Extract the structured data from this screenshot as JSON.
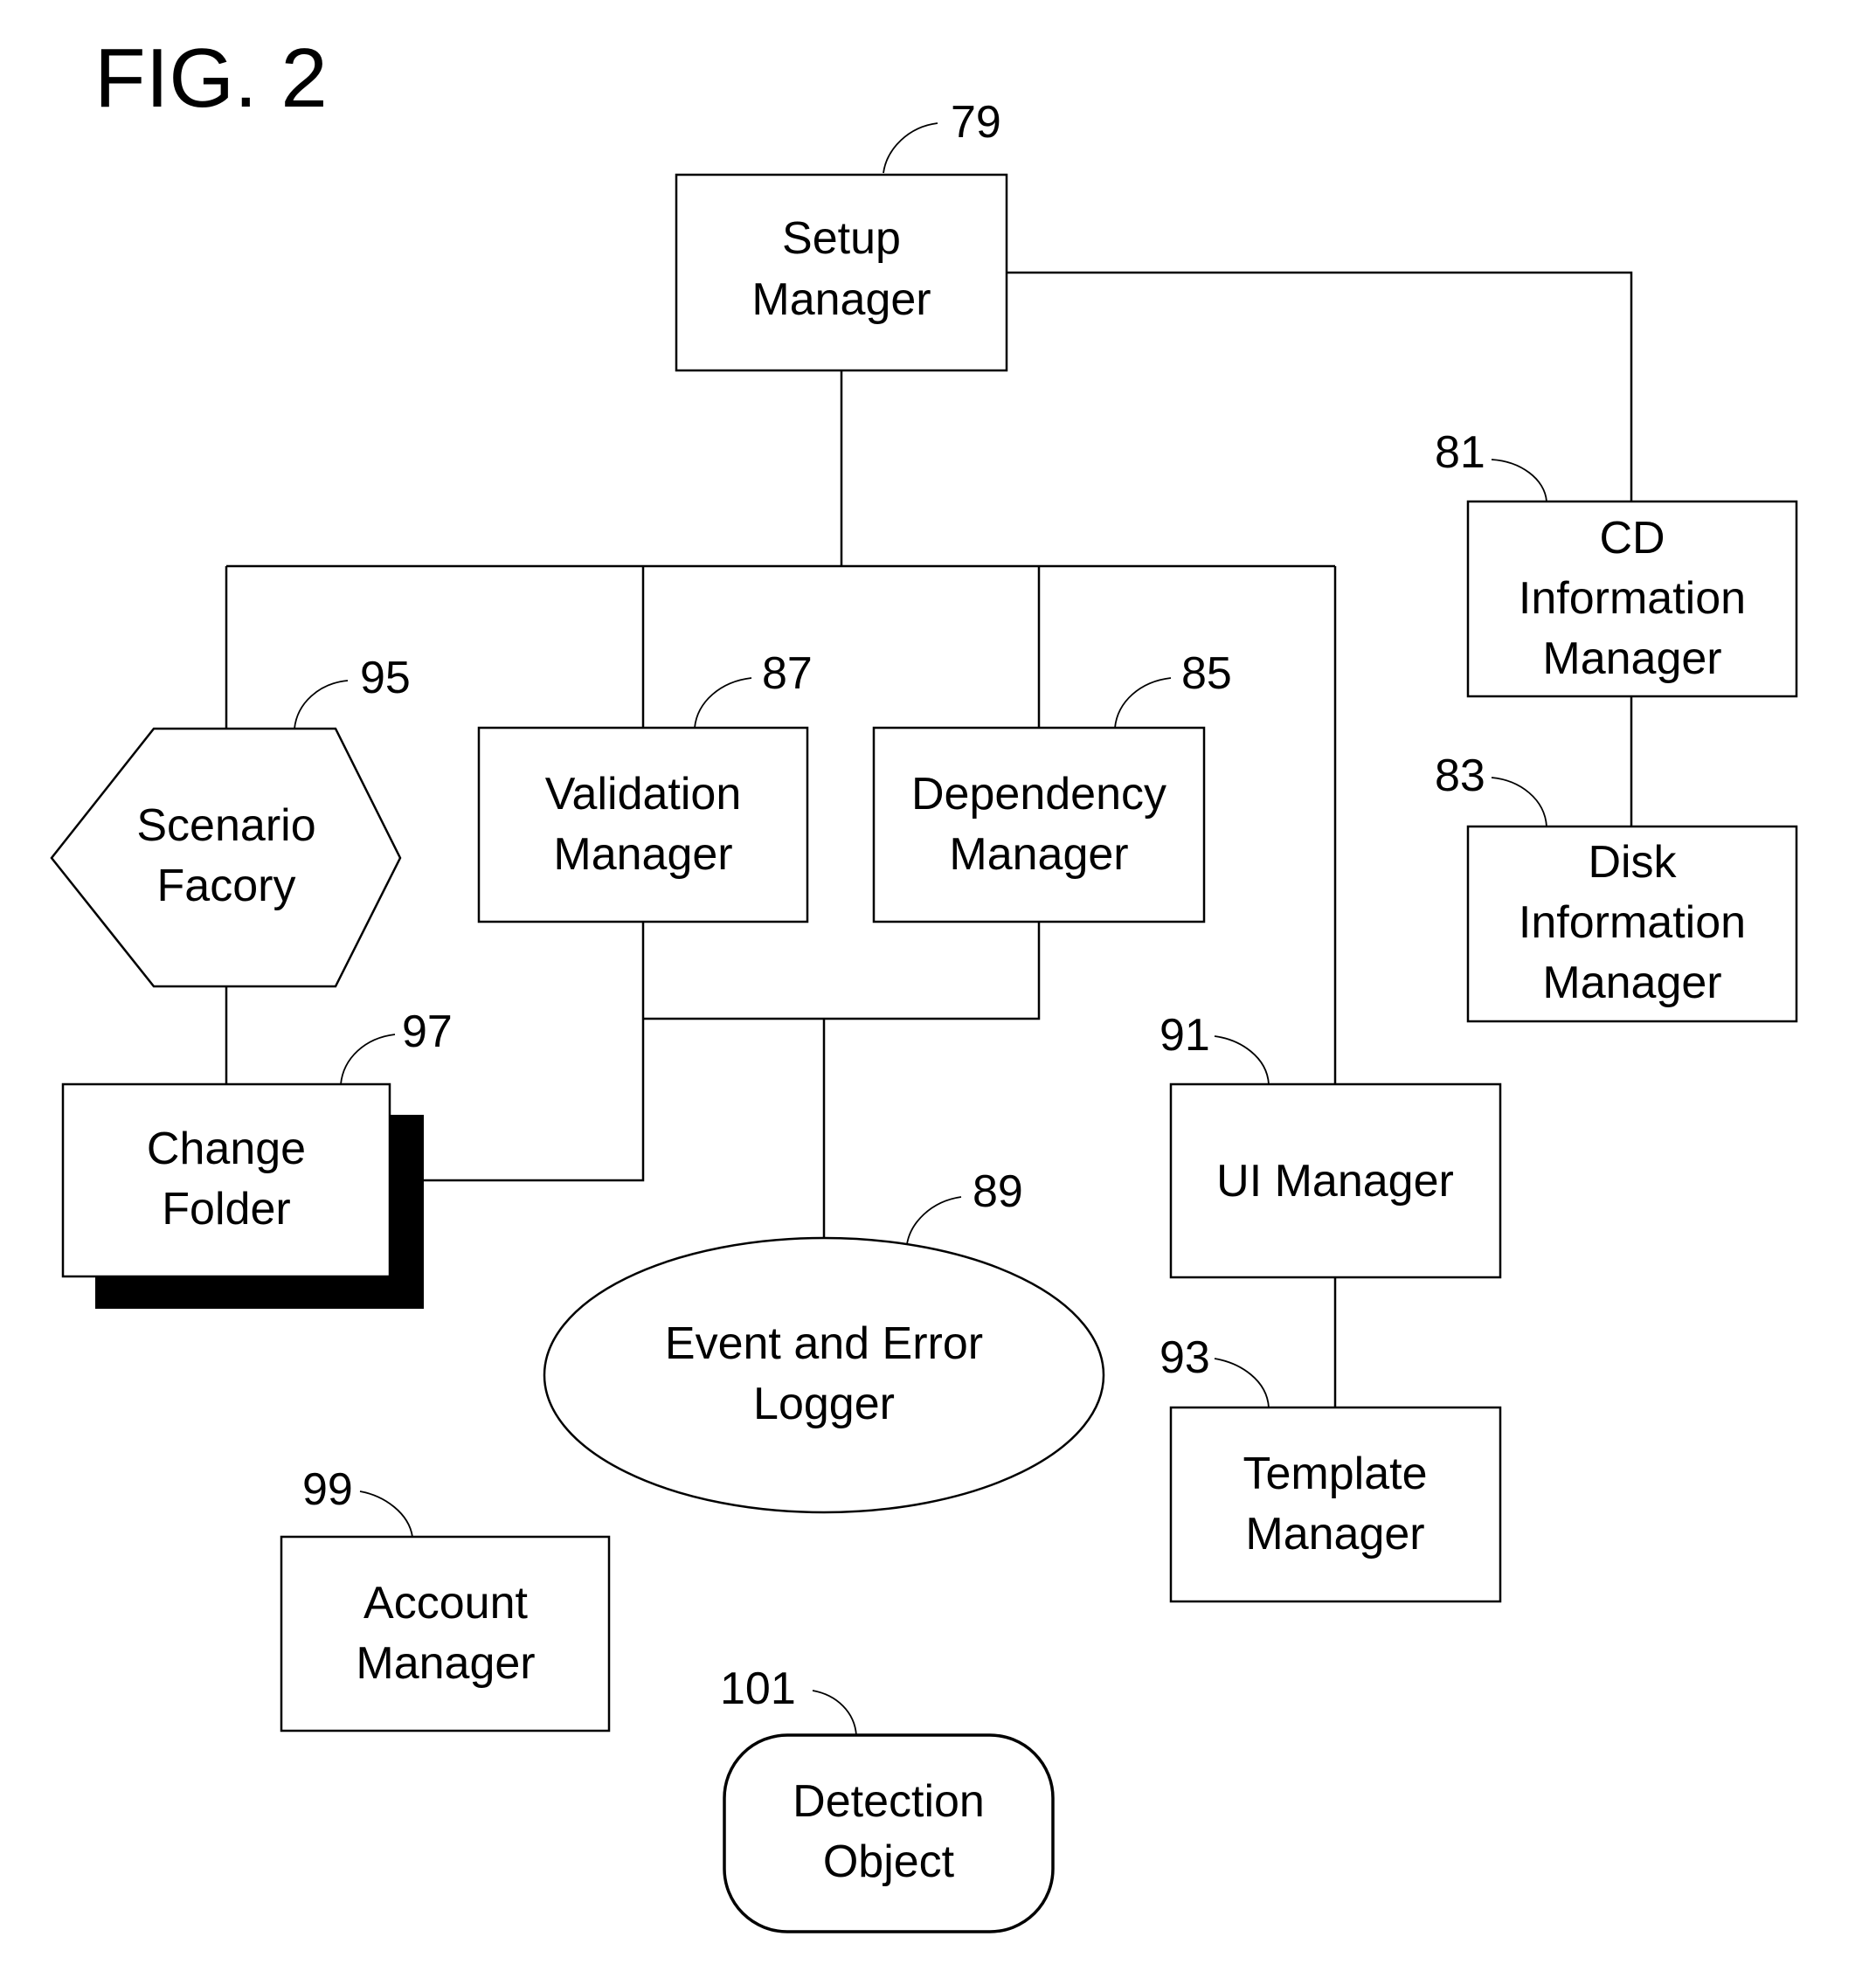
{
  "figure": {
    "title": "FIG. 2"
  },
  "nodes": {
    "setup_manager": {
      "ref": "79",
      "lines": [
        "Setup",
        "Manager"
      ],
      "shape": "rectangle"
    },
    "cd_info_manager": {
      "ref": "81",
      "lines": [
        "CD",
        "Information",
        "Manager"
      ],
      "shape": "rectangle"
    },
    "disk_info_manager": {
      "ref": "83",
      "lines": [
        "Disk",
        "Information",
        "Manager"
      ],
      "shape": "rectangle"
    },
    "dependency_manager": {
      "ref": "85",
      "lines": [
        "Dependency",
        "Manager"
      ],
      "shape": "rectangle"
    },
    "validation_manager": {
      "ref": "87",
      "lines": [
        "Validation",
        "Manager"
      ],
      "shape": "rectangle"
    },
    "event_error_logger": {
      "ref": "89",
      "lines": [
        "Event and Error",
        "Logger"
      ],
      "shape": "ellipse"
    },
    "ui_manager": {
      "ref": "91",
      "lines": [
        "UI Manager"
      ],
      "shape": "rectangle"
    },
    "template_manager": {
      "ref": "93",
      "lines": [
        "Template",
        "Manager"
      ],
      "shape": "rectangle"
    },
    "scenario_factory": {
      "ref": "95",
      "lines": [
        "Scenario",
        "Facory"
      ],
      "shape": "hexagon"
    },
    "change_folder": {
      "ref": "97",
      "lines": [
        "Change",
        "Folder"
      ],
      "shape": "rectangle-with-shadow"
    },
    "account_manager": {
      "ref": "99",
      "lines": [
        "Account",
        "Manager"
      ],
      "shape": "rectangle"
    },
    "detection_object": {
      "ref": "101",
      "lines": [
        "Detection",
        "Object"
      ],
      "shape": "rounded-rectangle"
    }
  },
  "connections": [
    [
      "setup_manager",
      "cd_info_manager"
    ],
    [
      "cd_info_manager",
      "disk_info_manager"
    ],
    [
      "setup_manager",
      "scenario_factory"
    ],
    [
      "setup_manager",
      "validation_manager"
    ],
    [
      "setup_manager",
      "dependency_manager"
    ],
    [
      "setup_manager",
      "ui_manager"
    ],
    [
      "scenario_factory",
      "change_folder"
    ],
    [
      "validation_manager",
      "change_folder"
    ],
    [
      "validation_manager",
      "event_error_logger"
    ],
    [
      "dependency_manager",
      "event_error_logger"
    ],
    [
      "ui_manager",
      "template_manager"
    ]
  ]
}
